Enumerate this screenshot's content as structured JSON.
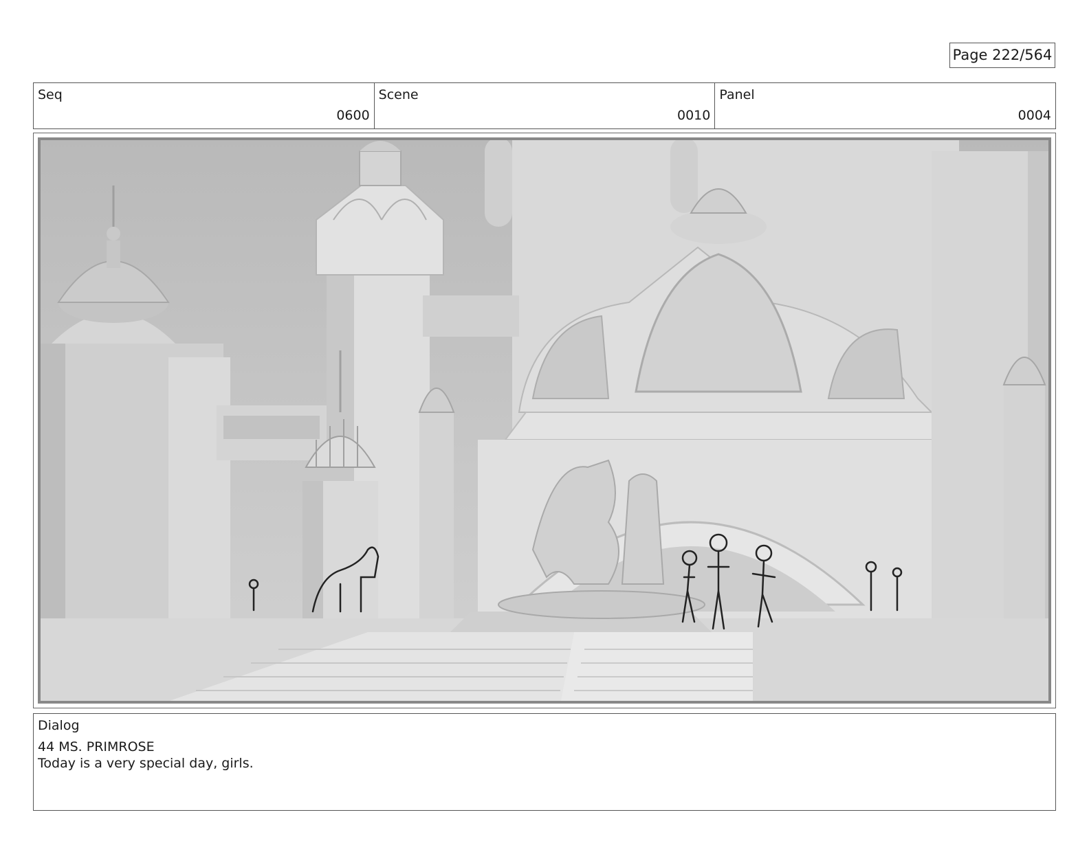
{
  "page": {
    "label": "Page 222/564"
  },
  "header": {
    "seq": {
      "label": "Seq",
      "value": "0600"
    },
    "scene": {
      "label": "Scene",
      "value": "0010"
    },
    "panel": {
      "label": "Panel",
      "value": "0004"
    }
  },
  "dialog": {
    "label": "Dialog",
    "speaker": "44 MS. PRIMROSE",
    "line": "Today is a very special day, girls."
  }
}
